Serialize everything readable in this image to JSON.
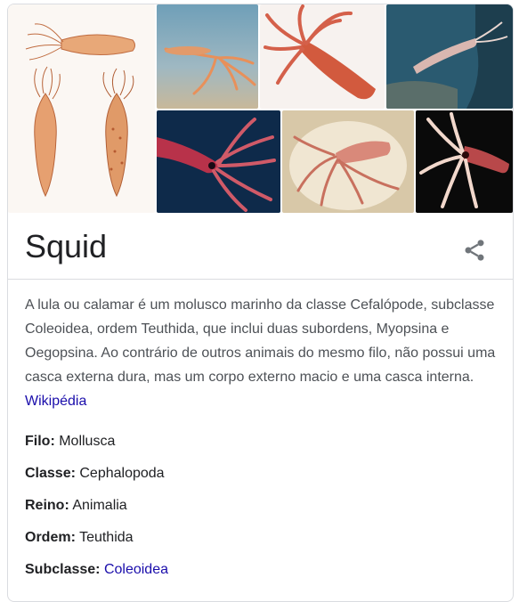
{
  "gallery": {
    "images": [
      {
        "name": "squid-illustration-image"
      },
      {
        "name": "squid-aquarium-image"
      },
      {
        "name": "squid-white-background-image"
      },
      {
        "name": "squid-ocean-image"
      },
      {
        "name": "squid-dark-water-image"
      },
      {
        "name": "squid-on-plate-image"
      },
      {
        "name": "squid-black-background-image"
      }
    ]
  },
  "entity": {
    "title": "Squid",
    "share_icon": "share-icon"
  },
  "description": {
    "text": "A lula ou calamar é um molusco marinho da classe Cefalópode, subclasse Coleoidea, ordem Teuthida, que inclui duas subordens, Myopsina e Oegopsina. Ao contrário de outros animais do mesmo filo, não possui uma casca externa dura, mas um corpo externo macio e uma casca interna.",
    "source_link": "Wikipédia"
  },
  "facts": [
    {
      "label": "Filo:",
      "value": "Mollusca",
      "link": false
    },
    {
      "label": "Classe:",
      "value": "Cephalopoda",
      "link": false
    },
    {
      "label": "Reino:",
      "value": "Animalia",
      "link": false
    },
    {
      "label": "Ordem:",
      "value": "Teuthida",
      "link": false
    },
    {
      "label": "Subclasse:",
      "value": "Coleoidea",
      "link": true
    }
  ],
  "colors": {
    "link": "#1a0dab",
    "text": "#202124",
    "secondary_text": "#4d5156",
    "border": "#dadce0"
  }
}
